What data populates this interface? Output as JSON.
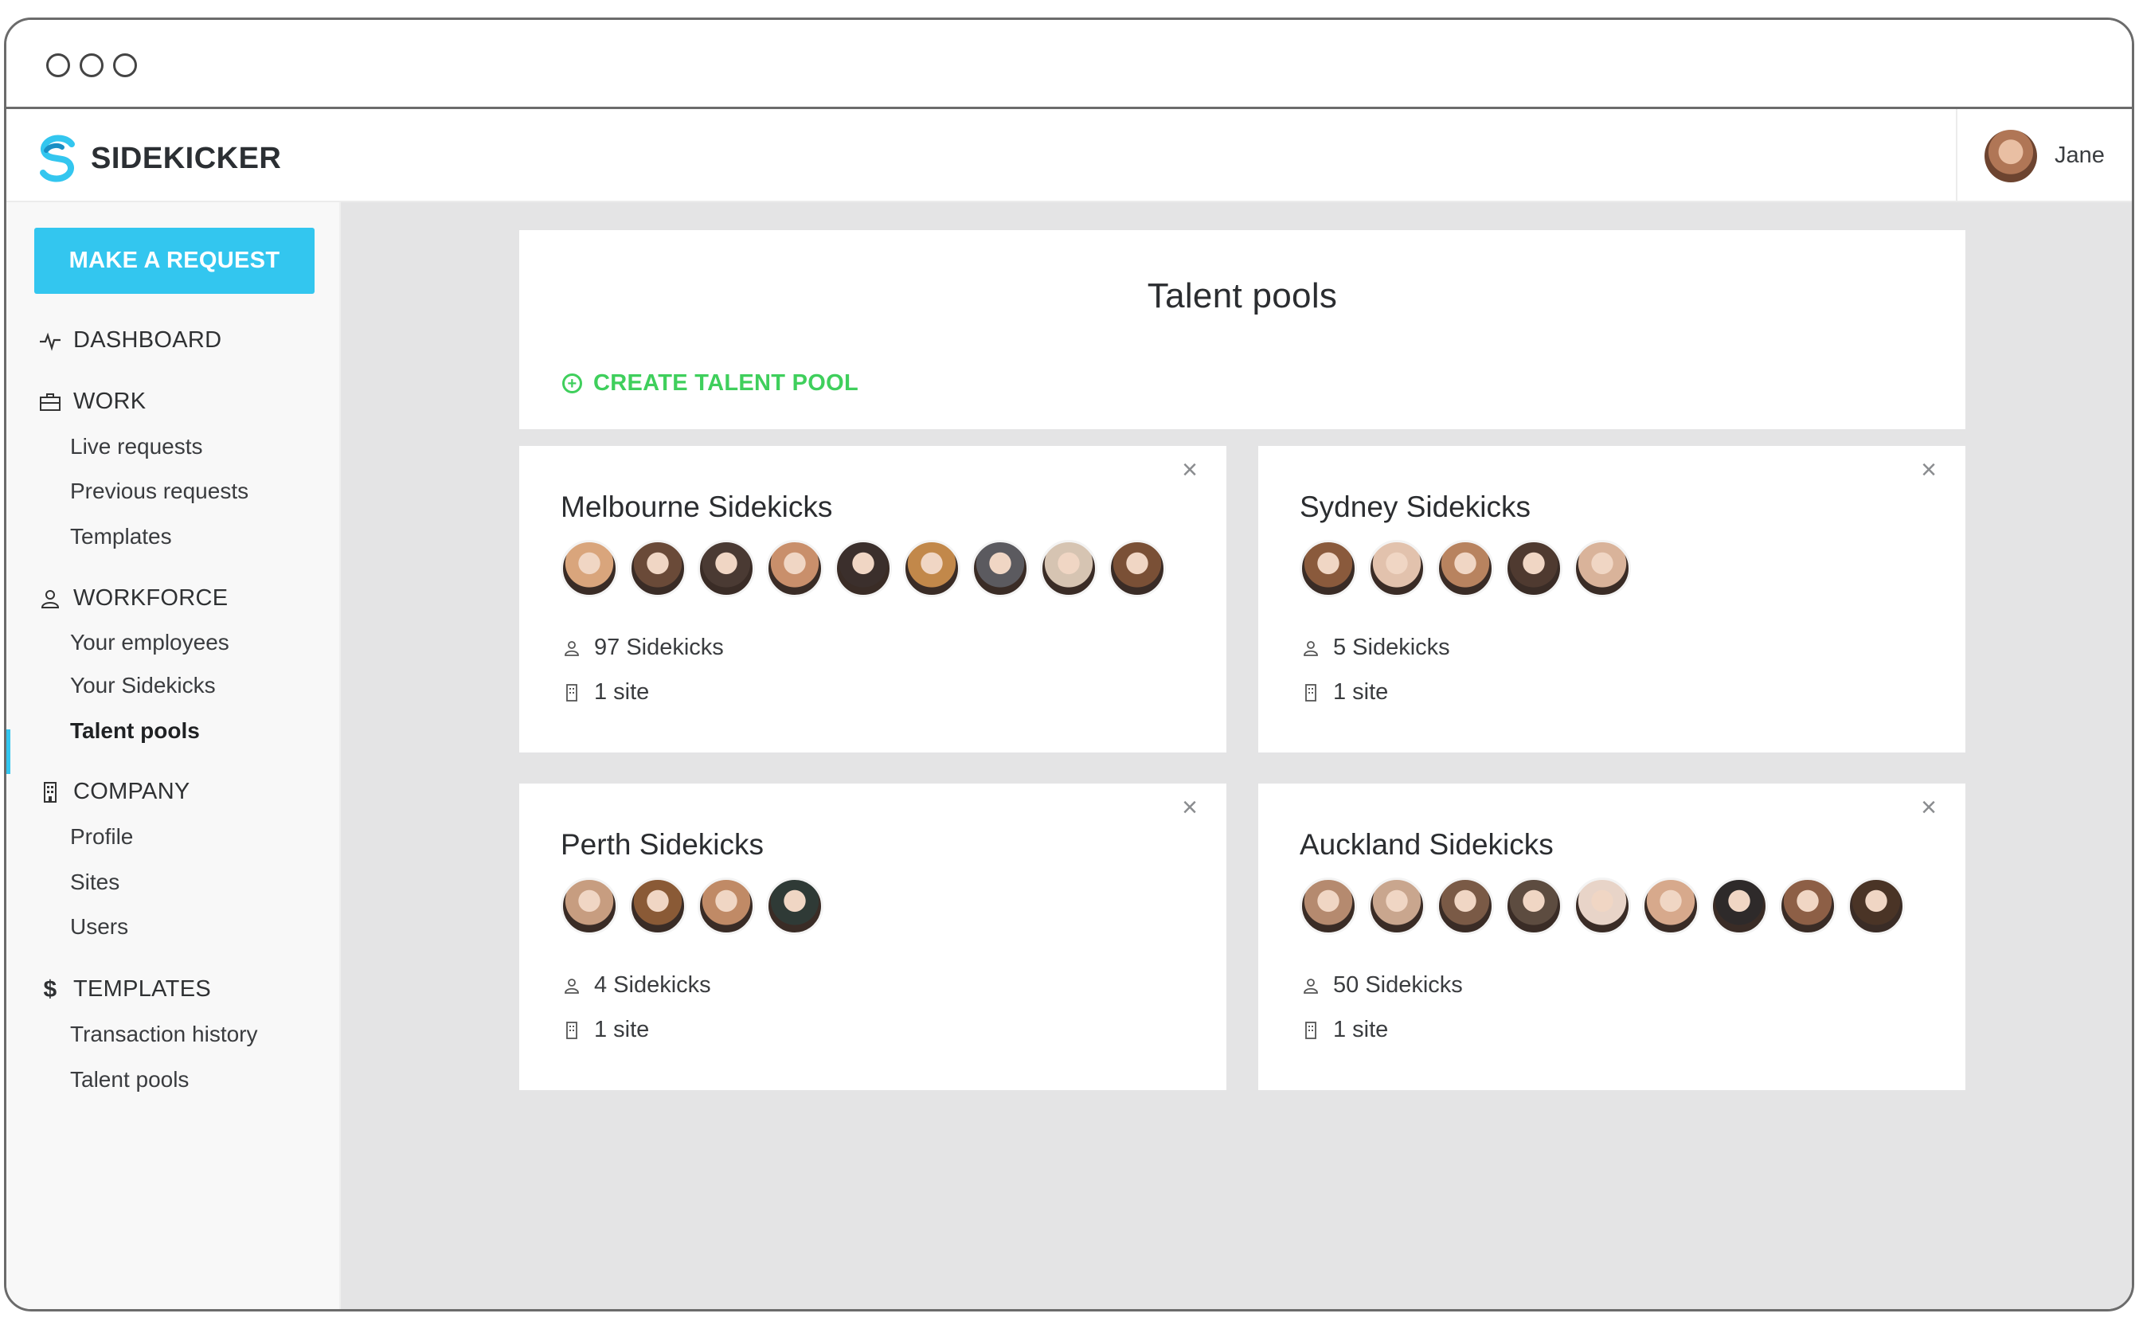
{
  "app": {
    "brand": "SIDEKICKER",
    "user_name": "Jane"
  },
  "sidebar": {
    "request_button": "MAKE A REQUEST",
    "sections": [
      {
        "label": "DASHBOARD",
        "icon": "activity-icon"
      },
      {
        "label": "WORK",
        "icon": "briefcase-icon",
        "items": [
          "Live requests",
          "Previous requests",
          "Templates"
        ]
      },
      {
        "label": "WORKFORCE",
        "icon": "person-icon",
        "items": [
          "Your employees",
          "Your Sidekicks",
          "Talent pools"
        ]
      },
      {
        "label": "COMPANY",
        "icon": "building-icon",
        "items": [
          "Profile",
          "Sites",
          "Users"
        ]
      },
      {
        "label": "TEMPLATES",
        "icon": "dollar-icon",
        "items": [
          "Transaction history",
          "Talent pools"
        ]
      }
    ],
    "active_item": "Talent pools"
  },
  "main": {
    "title": "Talent pools",
    "create_label": "CREATE TALENT POOL",
    "pools": [
      {
        "name": "Melbourne Sidekicks",
        "sidekicks": "97 Sidekicks",
        "sites": "1 site",
        "avatars": [
          "#d9a57c",
          "#6a4a38",
          "#4a3a33",
          "#c98f6b",
          "#3b2f2c",
          "#c2884a",
          "#5b5a5f",
          "#d6c4b2",
          "#7a5036"
        ]
      },
      {
        "name": "Sydney Sidekicks",
        "sidekicks": "5 Sidekicks",
        "sites": "1 site",
        "avatars": [
          "#8a5a3c",
          "#e2c2ad",
          "#b8835f",
          "#4f3a30",
          "#d9b39a"
        ]
      },
      {
        "name": "Perth Sidekicks",
        "sidekicks": "4 Sidekicks",
        "sites": "1 site",
        "avatars": [
          "#c79d80",
          "#8a5a36",
          "#c08a66",
          "#2f3a36"
        ]
      },
      {
        "name": "Auckland Sidekicks",
        "sidekicks": "50 Sidekicks",
        "sites": "1 site",
        "avatars": [
          "#b58a6f",
          "#c9a68e",
          "#7a5a46",
          "#5d4c40",
          "#e8d4c8",
          "#d7a98c",
          "#2e2a2a",
          "#8d5f46",
          "#4a3426"
        ]
      }
    ]
  },
  "colors": {
    "accent": "#33c6ef",
    "create": "#3fcf5c",
    "background": "#e4e4e5"
  }
}
